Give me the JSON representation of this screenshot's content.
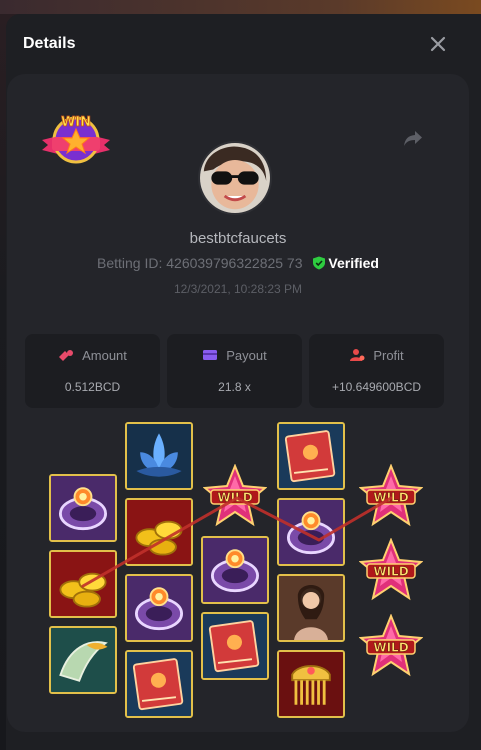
{
  "modal": {
    "title": "Details"
  },
  "player": {
    "username": "bestbtcfaucets",
    "betting_id_label": "Betting ID: 426039796322825 73",
    "verified_label": "Verified",
    "timestamp": "12/3/2021, 10:28:23 PM"
  },
  "badge": {
    "text": "WIN"
  },
  "stats": {
    "amount": {
      "label": "Amount",
      "value": "0.512BCD",
      "icon": "coins-icon",
      "color": "#e84a6a"
    },
    "payout": {
      "label": "Payout",
      "value": "21.8 x",
      "icon": "card-icon",
      "color": "#8a5cf0"
    },
    "profit": {
      "label": "Profit",
      "value": "+10.649600BCD",
      "icon": "user-coin-icon",
      "color": "#e84a4a"
    }
  },
  "reels": {
    "wild_text": "WILD",
    "columns": [
      [
        "ring",
        "gold",
        "scroll"
      ],
      [
        "lotus",
        "gold",
        "ring",
        "book"
      ],
      [
        "wild",
        "ring",
        "book"
      ],
      [
        "book",
        "ring",
        "lady",
        "comb"
      ],
      [
        "wild",
        "wild",
        "wild"
      ]
    ]
  },
  "colors": {
    "accent_gold": "#e2c04a",
    "verified_green": "#2ecc40",
    "payline": "#c0302a"
  }
}
